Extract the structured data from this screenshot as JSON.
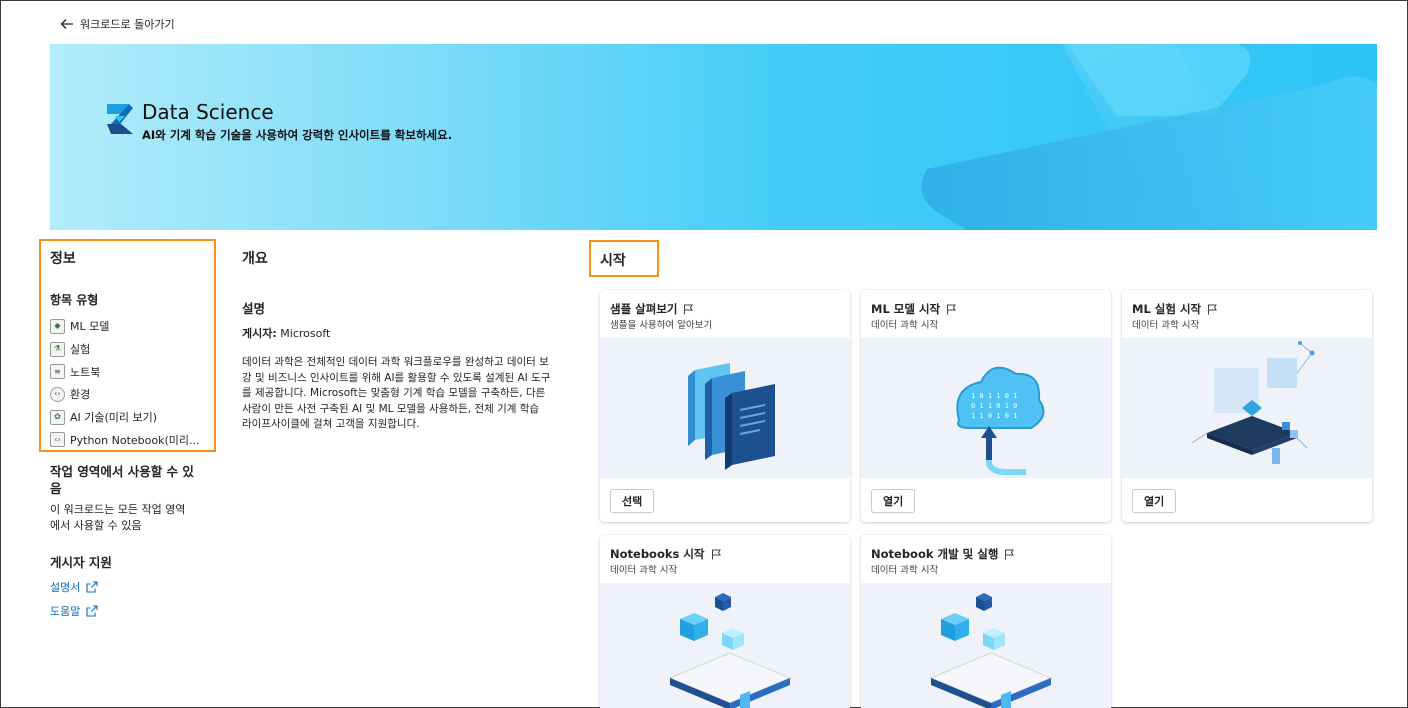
{
  "nav": {
    "back_label": "워크로드로 돌아가기"
  },
  "banner": {
    "title": "Data Science",
    "subtitle": "AI와 기계 학습 기술을 사용하여 강력한 인사이트를 확보하세요."
  },
  "info": {
    "heading": "정보",
    "item_types_heading": "항목 유형",
    "item_types": [
      {
        "label": "ML 모델",
        "icon": "ml-model-icon"
      },
      {
        "label": "실험",
        "icon": "experiment-icon"
      },
      {
        "label": "노트북",
        "icon": "notebook-icon"
      },
      {
        "label": "환경",
        "icon": "environment-icon"
      },
      {
        "label": "AI 기술(미리 보기)",
        "icon": "ai-skill-icon"
      },
      {
        "label": "Python Notebook(미리...",
        "icon": "python-notebook-icon"
      }
    ],
    "workspace_heading": "작업 영역에서 사용할 수 있음",
    "workspace_text": "이 워크로드는 모든 작업 영역에서 사용할 수 있음",
    "publisher_support_heading": "게시자 지원",
    "links": [
      {
        "label": "설명서"
      },
      {
        "label": "도움말"
      }
    ]
  },
  "overview": {
    "heading": "개요",
    "description_label": "설명",
    "publisher_label": "게시자:",
    "publisher_value": "Microsoft",
    "description": "데이터 과학은 전체적인 데이터 과학 워크플로우를 완성하고 데이터 보강 및 비즈니스 인사이트를 위해 AI를 활용할 수 있도록 설계된 AI 도구를 제공합니다. Microsoft는 맞춤형 기계 학습 모델을 구축하든, 다른 사람이 만든 사전 구축된 AI 및 ML 모델을 사용하든, 전체 기계 학습 라이프사이클에 걸쳐 고객을 지원합니다."
  },
  "start": {
    "heading": "시작",
    "cards": [
      {
        "title": "샘플 살펴보기",
        "subtitle": "샘플을 사용하여 알아보기",
        "button": "선택"
      },
      {
        "title": "ML 모델 시작",
        "subtitle": "데이터 과학 시작",
        "button": "열기"
      },
      {
        "title": "ML 실험 시작",
        "subtitle": "데이터 과학 시작",
        "button": "열기"
      },
      {
        "title": "Notebooks 시작",
        "subtitle": "데이터 과학 시작",
        "button": ""
      },
      {
        "title": "Notebook 개발 및 실행",
        "subtitle": "데이터 과학 시작",
        "button": ""
      }
    ]
  },
  "colors": {
    "accent": "#0f6cbd",
    "highlight": "#f7901e",
    "banner": "#45cdf7"
  }
}
